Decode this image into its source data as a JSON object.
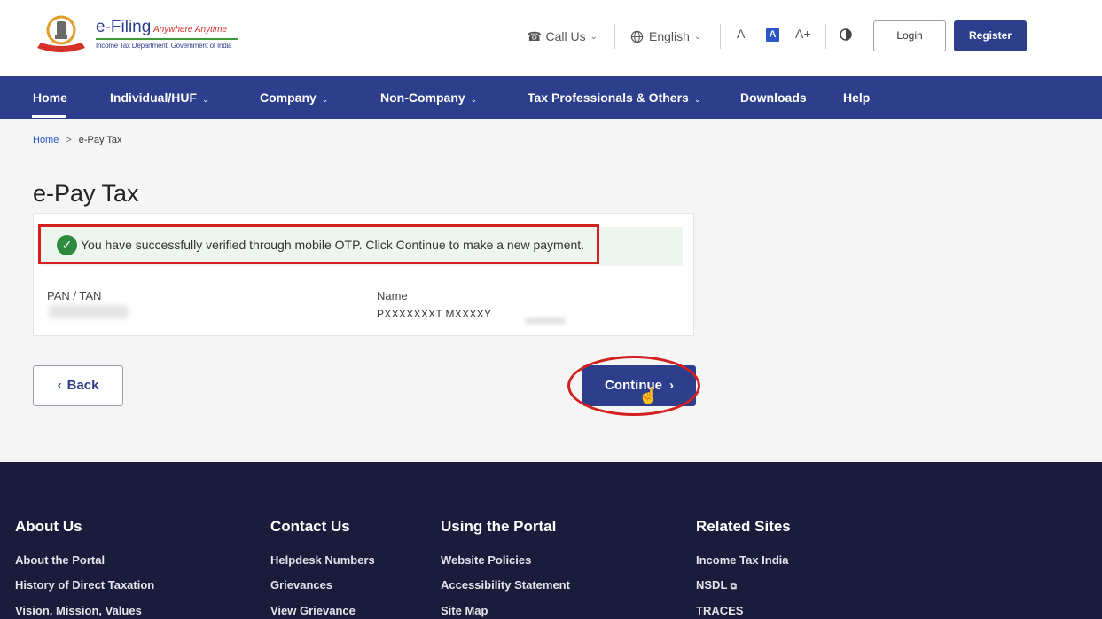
{
  "header": {
    "logo_title": "e-Filing",
    "logo_tagline": "Anywhere Anytime",
    "logo_subtitle": "Income Tax Department, Government of India",
    "call_us": "Call Us",
    "language": "English",
    "font_decrease": "A-",
    "font_default": "A",
    "font_increase": "A+",
    "login": "Login",
    "register": "Register"
  },
  "nav": {
    "items": [
      {
        "label": "Home",
        "dropdown": false
      },
      {
        "label": "Individual/HUF",
        "dropdown": true
      },
      {
        "label": "Company",
        "dropdown": true
      },
      {
        "label": "Non-Company",
        "dropdown": true
      },
      {
        "label": "Tax Professionals & Others",
        "dropdown": true
      },
      {
        "label": "Downloads",
        "dropdown": false
      },
      {
        "label": "Help",
        "dropdown": false
      }
    ]
  },
  "breadcrumb": {
    "home": "Home",
    "current": "e-Pay Tax"
  },
  "page": {
    "title": "e-Pay Tax",
    "success_message": "You have successfully verified through mobile OTP. Click Continue to make a new payment.",
    "pan_label": "PAN / TAN",
    "name_label": "Name",
    "name_value": "PXXXXXXXT MXXXXY",
    "back_label": "Back",
    "continue_label": "Continue"
  },
  "footer": {
    "columns": [
      {
        "heading": "About Us",
        "links": [
          "About the Portal",
          "History of Direct Taxation",
          "Vision, Mission, Values"
        ]
      },
      {
        "heading": "Contact Us",
        "links": [
          "Helpdesk Numbers",
          "Grievances",
          "View Grievance"
        ]
      },
      {
        "heading": "Using the Portal",
        "links": [
          "Website Policies",
          "Accessibility Statement",
          "Site Map"
        ]
      },
      {
        "heading": "Related Sites",
        "links": [
          "Income Tax India",
          "NSDL",
          "TRACES"
        ]
      }
    ]
  },
  "colors": {
    "primary": "#2d3f8c",
    "footer_bg": "#1b1c3c",
    "success": "#2e8b3e",
    "annotation": "#d32020"
  }
}
